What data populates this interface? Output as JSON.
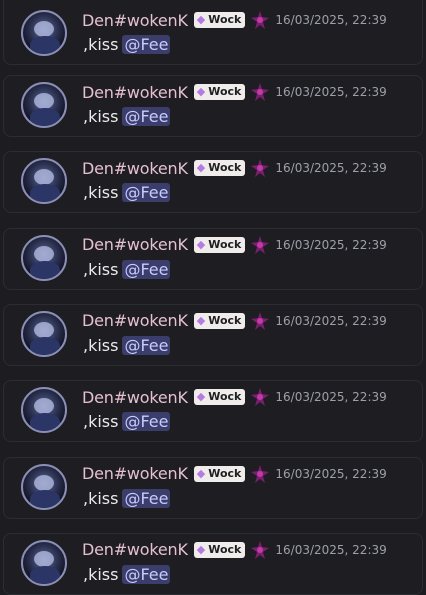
{
  "colors": {
    "background": "#1c1c21",
    "username": "#e5c0d1",
    "mention_bg": "#3b3e6b",
    "mention_text": "#c7cbff",
    "timestamp": "#9ea0a8"
  },
  "icons": {
    "badge": "crystal-icon",
    "decoration": "sparkle-emoji-icon"
  },
  "messages": [
    {
      "username": "Den#wokenK",
      "badge": "Wock",
      "timestamp": "16/03/2025, 22:39",
      "text": ",kiss",
      "mention": "@Fee"
    },
    {
      "username": "Den#wokenK",
      "badge": "Wock",
      "timestamp": "16/03/2025, 22:39",
      "text": ",kiss",
      "mention": "@Fee"
    },
    {
      "username": "Den#wokenK",
      "badge": "Wock",
      "timestamp": "16/03/2025, 22:39",
      "text": ",kiss",
      "mention": "@Fee"
    },
    {
      "username": "Den#wokenK",
      "badge": "Wock",
      "timestamp": "16/03/2025, 22:39",
      "text": ",kiss",
      "mention": "@Fee"
    },
    {
      "username": "Den#wokenK",
      "badge": "Wock",
      "timestamp": "16/03/2025, 22:39",
      "text": ",kiss",
      "mention": "@Fee"
    },
    {
      "username": "Den#wokenK",
      "badge": "Wock",
      "timestamp": "16/03/2025, 22:39",
      "text": ",kiss",
      "mention": "@Fee"
    },
    {
      "username": "Den#wokenK",
      "badge": "Wock",
      "timestamp": "16/03/2025, 22:39",
      "text": ",kiss",
      "mention": "@Fee"
    },
    {
      "username": "Den#wokenK",
      "badge": "Wock",
      "timestamp": "16/03/2025, 22:39",
      "text": ",kiss",
      "mention": "@Fee"
    }
  ]
}
